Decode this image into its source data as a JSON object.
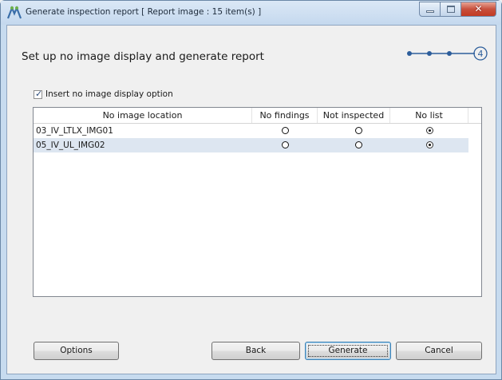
{
  "window": {
    "title": "Generate inspection report  [ Report image : 15 item(s) ]",
    "close_glyph": "✕"
  },
  "heading": "Set up no image display and generate report",
  "steps": {
    "current": "4",
    "total": 4
  },
  "insert_option": {
    "label": "Insert no image display option",
    "checked": true
  },
  "grid": {
    "columns": [
      "No image location",
      "No findings",
      "Not inspected",
      "No list"
    ],
    "rows": [
      {
        "location": "03_IV_LTLX_IMG01",
        "selected": "No list"
      },
      {
        "location": "05_IV_UL_IMG02",
        "selected": "No list"
      }
    ]
  },
  "buttons": {
    "options": "Options",
    "back": "Back",
    "generate": "Generate",
    "cancel": "Cancel"
  },
  "colors": {
    "accent": "#2d5e9b",
    "row_alt": "#dde6f1"
  }
}
